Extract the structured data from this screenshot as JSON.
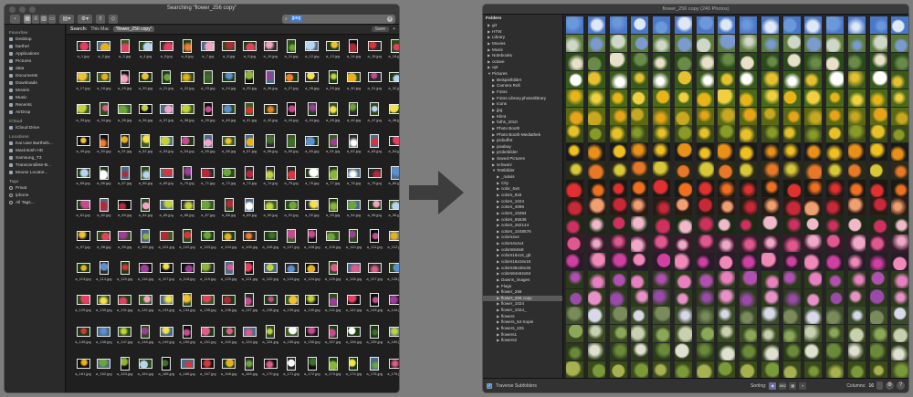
{
  "finder": {
    "title": "Searching “flower_256 copy”",
    "search_token": "jpeg",
    "scope_label": "Search:",
    "scope_this_mac": "This Mac",
    "scope_selected": "“flower_256 copy”",
    "save_label": "Save",
    "sidebar": [
      {
        "heading": "Favorites",
        "items": [
          "Desktop",
          "barthel",
          "Applications",
          "Pictures",
          "data",
          "Documents",
          "Downloads",
          "Movies",
          "Music",
          "Recents",
          "AirDrop"
        ]
      },
      {
        "heading": "iCloud",
        "items": [
          "iCloud Drive"
        ]
      },
      {
        "heading": "Locations",
        "items": [
          "Kai Uwe Barthels...",
          "Macintosh HD",
          "Samsung_T3",
          "Transcendinte-B...",
          "Mouse Locator..."
        ]
      },
      {
        "heading": "Tags",
        "items": [
          "Privat",
          "iphone",
          "All Tags..."
        ]
      }
    ],
    "files_visible": [
      "a_1.jpg",
      "a_2.jpg",
      "a_3.jpg",
      "a_4.jpg",
      "a_5.jpg",
      "a_6.jpg",
      "a_7.jpg",
      "a_8.jpg",
      "a_9.jpg",
      "a_10.jpg",
      "a_11.jpg",
      "a_12.jpg",
      "a_13.jpg",
      "a_14.jpg",
      "a_15.jpg",
      "a_16.jpg",
      "a_17.jpg",
      "a_18.jpg",
      "a_19.jpg",
      "a_20.jpg",
      "a_21.jpg",
      "a_22.jpg",
      "a_23.jpg",
      "a_24.jpg",
      "a_25.jpg",
      "a_26.jpg",
      "a_27.jpg",
      "a_28.jpg",
      "a_29.jpg",
      "a_30.jpg",
      "a_31.jpg",
      "a_32.jpg",
      "a_33.jpg",
      "a_34.jpg",
      "a_35.jpg",
      "a_36.jpg",
      "a_37.jpg",
      "a_38.jpg",
      "a_39.jpg",
      "a_40.jpg",
      "a_41.jpg",
      "a_42.jpg",
      "a_43.jpg",
      "a_44.jpg",
      "a_45.jpg",
      "a_46.jpg",
      "a_47.jpg",
      "a_48.jpg",
      "a_49.jpg",
      "a_50.jpg",
      "a_51.jpg",
      "a_52.jpg",
      "a_53.jpg",
      "a_54.jpg",
      "a_55.jpg",
      "a_56.jpg",
      "a_57.jpg",
      "a_58.jpg",
      "a_59.jpg",
      "a_60.jpg",
      "a_61.jpg",
      "a_62.jpg",
      "a_63.jpg",
      "a_64.jpg",
      "a_65.jpg",
      "a_66.jpg",
      "a_67.jpg",
      "a_68.jpg",
      "a_69.jpg",
      "a_70.jpg",
      "a_71.jpg",
      "a_72.jpg",
      "a_73.jpg",
      "a_74.jpg",
      "a_75.jpg",
      "a_76.jpg",
      "a_77.jpg",
      "a_78.jpg",
      "a_79.jpg",
      "a_80.jpg",
      "a_81.jpg",
      "a_82.jpg",
      "a_83.jpg",
      "a_84.jpg",
      "a_85.jpg",
      "a_86.jpg",
      "a_87.jpg",
      "a_88.jpg",
      "a_89.jpg",
      "a_90.jpg",
      "a_91.jpg",
      "a_92.jpg",
      "a_93.jpg",
      "a_94.jpg",
      "a_95.jpg",
      "a_96.jpg",
      "a_97.jpg",
      "a_98.jpg",
      "a_99.jpg",
      "a_100.jpg",
      "a_101.jpg",
      "a_102.jpg",
      "a_103.jpg",
      "a_104.jpg",
      "a_105.jpg",
      "a_106.jpg",
      "a_107.jpg",
      "a_108.jpg",
      "a_109.jpg",
      "a_110.jpg",
      "a_111.jpg",
      "a_112.jpg",
      "a_113.jpg",
      "a_114.jpg",
      "a_115.jpg",
      "a_116.jpg",
      "a_117.jpg",
      "a_118.jpg",
      "a_119.jpg",
      "a_120.jpg",
      "a_121.jpg",
      "a_122.jpg",
      "a_123.jpg",
      "a_124.jpg",
      "a_125.jpg",
      "a_126.jpg",
      "a_127.jpg",
      "a_128.jpg",
      "a_129.jpg",
      "a_130.jpg",
      "a_131.jpg",
      "a_132.jpg",
      "a_133.jpg",
      "a_134.jpg",
      "a_135.jpg",
      "a_136.jpg",
      "a_137.jpg",
      "a_138.jpg",
      "a_139.jpg",
      "a_140.jpg",
      "a_141.jpg",
      "a_142.jpg",
      "a_143.jpg",
      "a_144.jpg",
      "a_145.jpg",
      "a_146.jpg",
      "a_147.jpg",
      "a_148.jpg",
      "a_149.jpg",
      "a_150.jpg",
      "a_151.jpg",
      "a_152.jpg",
      "a_153.jpg",
      "a_154.jpg",
      "a_155.jpg",
      "a_156.jpg",
      "a_157.jpg",
      "a_158.jpg",
      "a_159.jpg",
      "a_160.jpg",
      "a_161.jpg",
      "a_162.jpg",
      "a_163.jpg",
      "a_164.jpg",
      "a_165.jpg",
      "a_166.jpg",
      "a_167.jpg",
      "a_168.jpg",
      "a_169.jpg",
      "a_170.jpg",
      "a_171.jpg",
      "a_172.jpg",
      "a_173.jpg",
      "a_174.jpg",
      "a_175.jpg",
      "a_176.jpg"
    ]
  },
  "viewer": {
    "title": "flower_256 copy (240 Photos)",
    "sidebar_heading": "Folders",
    "folders": [
      {
        "name": "git",
        "d": 1,
        "exp": false
      },
      {
        "name": "HTW",
        "d": 1,
        "exp": false
      },
      {
        "name": "Library",
        "d": 1,
        "exp": false
      },
      {
        "name": "Movies",
        "d": 1,
        "exp": false
      },
      {
        "name": "Music",
        "d": 1,
        "exp": false
      },
      {
        "name": "Notebooks",
        "d": 1,
        "exp": false
      },
      {
        "name": "octave",
        "d": 1,
        "exp": false
      },
      {
        "name": "opt",
        "d": 1,
        "exp": false
      },
      {
        "name": "Pictures",
        "d": 1,
        "exp": true
      },
      {
        "name": "Beispielbilder",
        "d": 2,
        "exp": false
      },
      {
        "name": "Camera Roll",
        "d": 2,
        "exp": false
      },
      {
        "name": "Fotos",
        "d": 2,
        "exp": false
      },
      {
        "name": "Fotos Library.photoslibrary",
        "d": 2,
        "exp": false
      },
      {
        "name": "Icons",
        "d": 2,
        "exp": false
      },
      {
        "name": "jpg",
        "d": 2,
        "exp": false
      },
      {
        "name": "Klimt",
        "d": 2,
        "exp": false
      },
      {
        "name": "hdhs_2010",
        "d": 2,
        "exp": false
      },
      {
        "name": "Photo Booth",
        "d": 2,
        "exp": false
      },
      {
        "name": "Photo Booth-Mediathek",
        "d": 2,
        "exp": false
      },
      {
        "name": "picbuffet",
        "d": 2,
        "exp": false
      },
      {
        "name": "pixabay",
        "d": 2,
        "exp": false
      },
      {
        "name": "probebilder",
        "d": 2,
        "exp": false
      },
      {
        "name": "Saved Pictures",
        "d": 2,
        "exp": false
      },
      {
        "name": "schwarz",
        "d": 2,
        "exp": false
      },
      {
        "name": "Testbilder",
        "d": 2,
        "exp": true
      },
      {
        "name": "_natvis",
        "d": 3,
        "exp": false
      },
      {
        "name": "City",
        "d": 3,
        "exp": false
      },
      {
        "name": "color_6x6",
        "d": 3,
        "exp": false
      },
      {
        "name": "colors_8x8",
        "d": 3,
        "exp": false
      },
      {
        "name": "colors_1024",
        "d": 3,
        "exp": false
      },
      {
        "name": "colors_4096",
        "d": 3,
        "exp": false
      },
      {
        "name": "colors_16384",
        "d": 3,
        "exp": false
      },
      {
        "name": "colors_65536",
        "d": 3,
        "exp": false
      },
      {
        "name": "colors_262144",
        "d": 3,
        "exp": false
      },
      {
        "name": "colors_1048576",
        "d": 3,
        "exp": false
      },
      {
        "name": "colors4x4",
        "d": 3,
        "exp": false
      },
      {
        "name": "colors4x4x4",
        "d": 3,
        "exp": false
      },
      {
        "name": "colors8x8x8",
        "d": 3,
        "exp": false
      },
      {
        "name": "colors16x16_gb",
        "d": 3,
        "exp": false
      },
      {
        "name": "colors16x16x16",
        "d": 3,
        "exp": false
      },
      {
        "name": "colors36x36x36",
        "d": 3,
        "exp": false
      },
      {
        "name": "colors64x64x64",
        "d": 3,
        "exp": false
      },
      {
        "name": "Dawns_images",
        "d": 3,
        "exp": false
      },
      {
        "name": "Flags",
        "d": 3,
        "exp": false
      },
      {
        "name": "flower_256",
        "d": 3,
        "exp": false
      },
      {
        "name": "flower_256 copy",
        "d": 3,
        "exp": false,
        "sel": true
      },
      {
        "name": "flower_1024",
        "d": 3,
        "exp": false
      },
      {
        "name": "flower_1024_",
        "d": 3,
        "exp": false
      },
      {
        "name": "flowers",
        "d": 3,
        "exp": false
      },
      {
        "name": "flowers_64 Kopie",
        "d": 3,
        "exp": false
      },
      {
        "name": "flowers_225",
        "d": 3,
        "exp": false
      },
      {
        "name": "flowers1",
        "d": 3,
        "exp": false
      },
      {
        "name": "flowers2",
        "d": 3,
        "exp": false
      }
    ],
    "traverse_label": "Traverse Subfolders",
    "sorting_label": "Sorting:",
    "sort_abc": "ABC",
    "columns_label": "Columns:",
    "columns_value": "16"
  },
  "colors": {
    "finder_bg": "#1f1f1f",
    "viewer_bg": "#252525",
    "accent": "#3b7ddd"
  }
}
